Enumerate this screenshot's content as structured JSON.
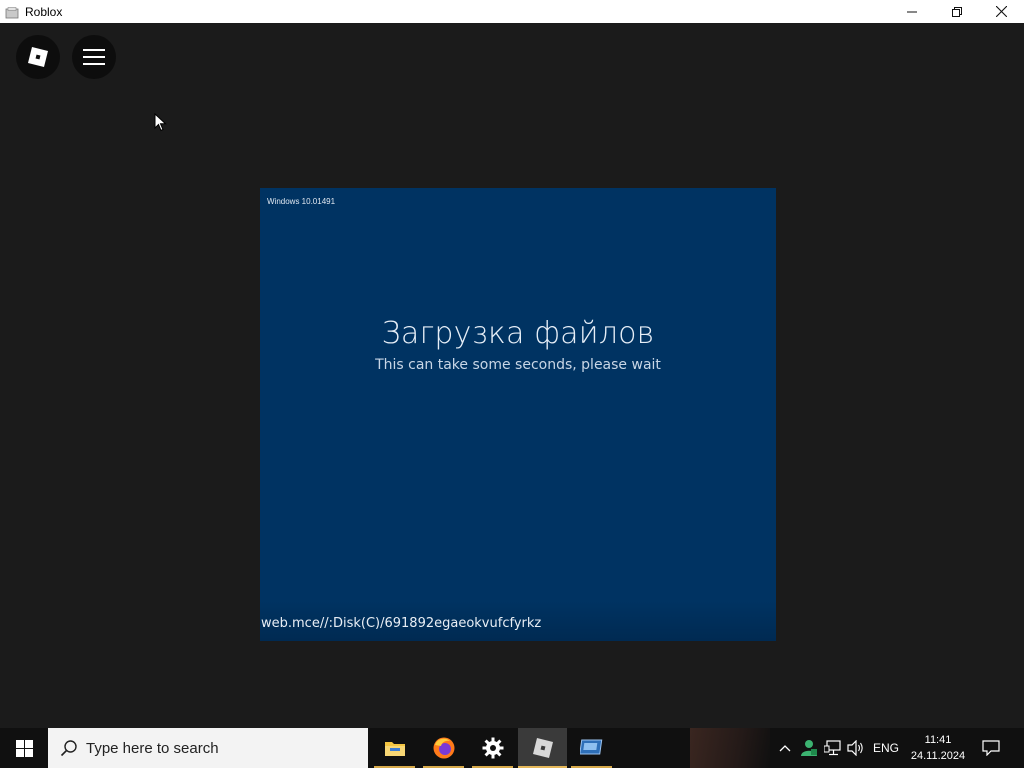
{
  "window": {
    "title": "Roblox",
    "controls": [
      "minimize",
      "restore",
      "close"
    ]
  },
  "game": {
    "buttons": [
      {
        "name": "roblox-logo"
      },
      {
        "name": "menu"
      }
    ],
    "panel": {
      "build": "Windows 10.01491",
      "heading": "Загрузка файлов",
      "subtitle": "This can take some seconds, please wait",
      "path": "web.mce//:Disk(C)/691892egaeokvufcfyrkz"
    }
  },
  "taskbar": {
    "search_placeholder": "Type here to search",
    "apps": [
      "file-explorer",
      "firefox",
      "settings",
      "roblox",
      "remote-desktop"
    ],
    "active_app": "roblox",
    "tray": {
      "language": "ENG",
      "time": "11:41",
      "date": "24.11.2024"
    }
  },
  "colors": {
    "panel_bg": "#003362",
    "game_bg": "#1b1b1b",
    "taskbar_bg": "#101010",
    "accent": "#e5b85a"
  }
}
